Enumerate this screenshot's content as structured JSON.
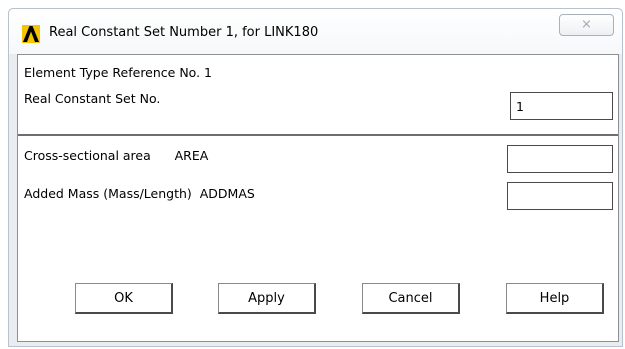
{
  "window": {
    "title": "Real Constant Set Number 1, for LINK180",
    "close_glyph": "⨯"
  },
  "info": {
    "element_type_reference": "Element Type Reference No. 1",
    "real_constant_set_label": "Real Constant Set No.",
    "real_constant_set_value": "1"
  },
  "fields": [
    {
      "label": "Cross-sectional area      AREA",
      "value": ""
    },
    {
      "label": "Added Mass (Mass/Length)  ADDMAS",
      "value": ""
    }
  ],
  "buttons": {
    "ok": "OK",
    "apply": "Apply",
    "cancel": "Cancel",
    "help": "Help"
  },
  "colors": {
    "logo_yellow": "#f5c400",
    "logo_black": "#000000"
  }
}
